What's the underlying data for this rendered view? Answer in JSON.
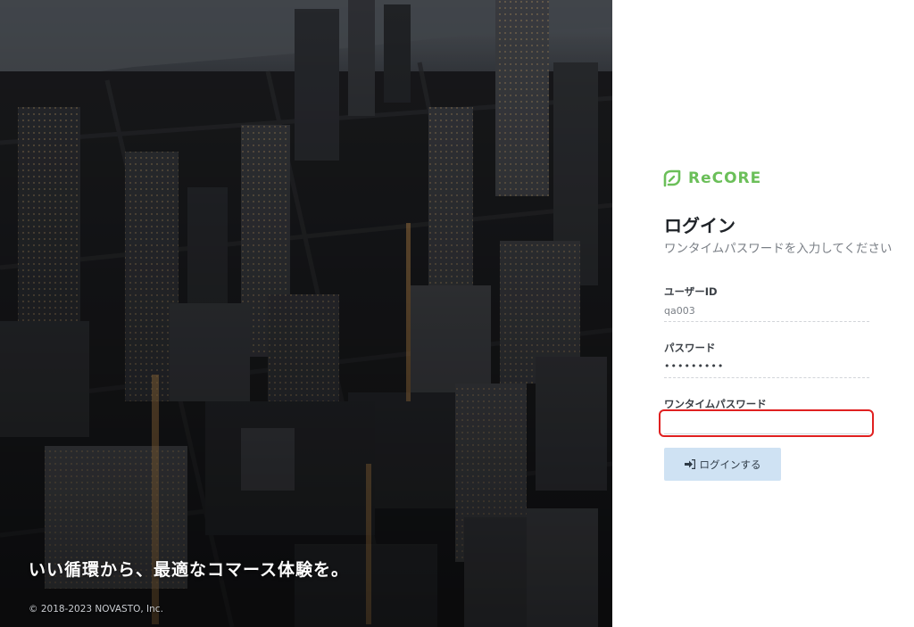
{
  "hero": {
    "tagline": "いい循環から、最適なコマース体験を。",
    "copyright": "© 2018-2023 NOVASTO, Inc."
  },
  "brand": {
    "name": "ReCORE",
    "color": "#6bbf59",
    "icon": "recore-leaf-icon"
  },
  "login": {
    "title": "ログイン",
    "subtitle": "ワンタイムパスワードを入力してください",
    "user_id_label": "ユーザーID",
    "user_id_value": "qa003",
    "password_label": "パスワード",
    "password_value": "•••••••••",
    "otp_label": "ワンタイムパスワード",
    "otp_value": "",
    "otp_placeholder": "",
    "submit_label": "ログインする",
    "submit_icon": "sign-in-icon"
  },
  "colors": {
    "highlight_border": "#e02020",
    "button_bg": "#cfe2f3"
  }
}
